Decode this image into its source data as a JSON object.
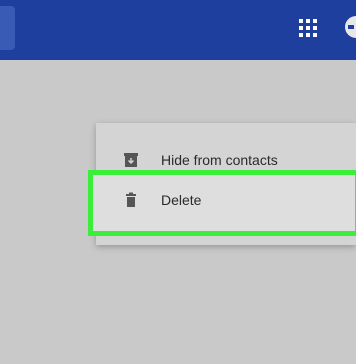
{
  "menu": {
    "items": [
      {
        "label": "Hide from contacts",
        "icon": "archive-icon"
      },
      {
        "label": "Delete",
        "icon": "trash-icon"
      }
    ]
  },
  "colors": {
    "app_bar": "#1e3f9e",
    "highlight": "#3aee3a",
    "background": "#c9c9c9"
  }
}
